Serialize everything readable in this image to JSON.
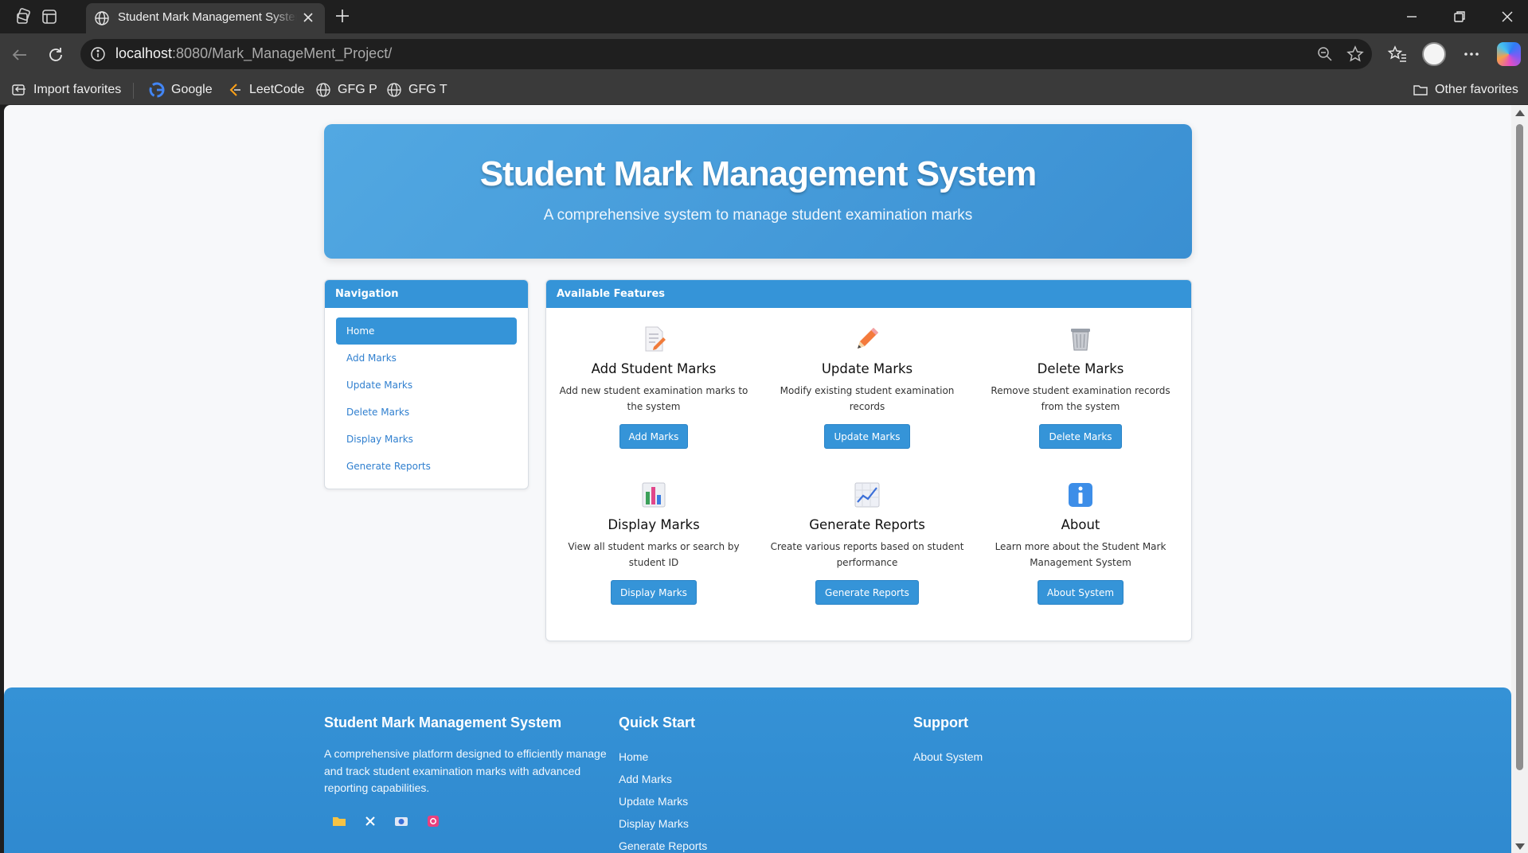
{
  "browser": {
    "tab_title": "Student Mark Management System",
    "url_host": "localhost",
    "url_rest": ":8080/Mark_ManageMent_Project/",
    "favorites": [
      {
        "label": "Import favorites",
        "icon": "import-icon"
      },
      {
        "label": "Google",
        "icon": "google-icon"
      },
      {
        "label": "LeetCode",
        "icon": "leetcode-icon"
      },
      {
        "label": "GFG P",
        "icon": "globe-icon"
      },
      {
        "label": "GFG T",
        "icon": "globe-icon"
      }
    ],
    "other_favorites": "Other favorites"
  },
  "hero": {
    "title": "Student Mark Management System",
    "subtitle": "A comprehensive system to manage student examination marks"
  },
  "navigation": {
    "heading": "Navigation",
    "items": [
      "Home",
      "Add Marks",
      "Update Marks",
      "Delete Marks",
      "Display Marks",
      "Generate Reports"
    ],
    "active": "Home"
  },
  "features": {
    "heading": "Available Features",
    "items": [
      {
        "icon": "memo-icon",
        "title": "Add Student Marks",
        "desc": "Add new student examination marks to the system",
        "button": "Add Marks"
      },
      {
        "icon": "pencil-icon",
        "title": "Update Marks",
        "desc": "Modify existing student examination records",
        "button": "Update Marks"
      },
      {
        "icon": "wastebasket-icon",
        "title": "Delete Marks",
        "desc": "Remove student examination records from the system",
        "button": "Delete Marks"
      },
      {
        "icon": "bar-chart-icon",
        "title": "Display Marks",
        "desc": "View all student marks or search by student ID",
        "button": "Display Marks"
      },
      {
        "icon": "line-chart-icon",
        "title": "Generate Reports",
        "desc": "Create various reports based on student performance",
        "button": "Generate Reports"
      },
      {
        "icon": "info-icon",
        "title": "About",
        "desc": "Learn more about the Student Mark Management System",
        "button": "About System"
      }
    ]
  },
  "footer": {
    "col1_title": "Student Mark Management System",
    "col1_desc": "A comprehensive platform designed to efficiently manage and track student examination marks with advanced reporting capabilities.",
    "col2_title": "Quick Start",
    "col2_links": [
      "Home",
      "Add Marks",
      "Update Marks",
      "Display Marks",
      "Generate Reports"
    ],
    "col3_title": "Support",
    "col3_links": [
      "About System"
    ],
    "social_icons": [
      "folder-icon",
      "x-icon",
      "camera-icon",
      "instagram-icon"
    ]
  },
  "colors": {
    "primary": "#3594d8",
    "link": "#2f7fcf"
  }
}
